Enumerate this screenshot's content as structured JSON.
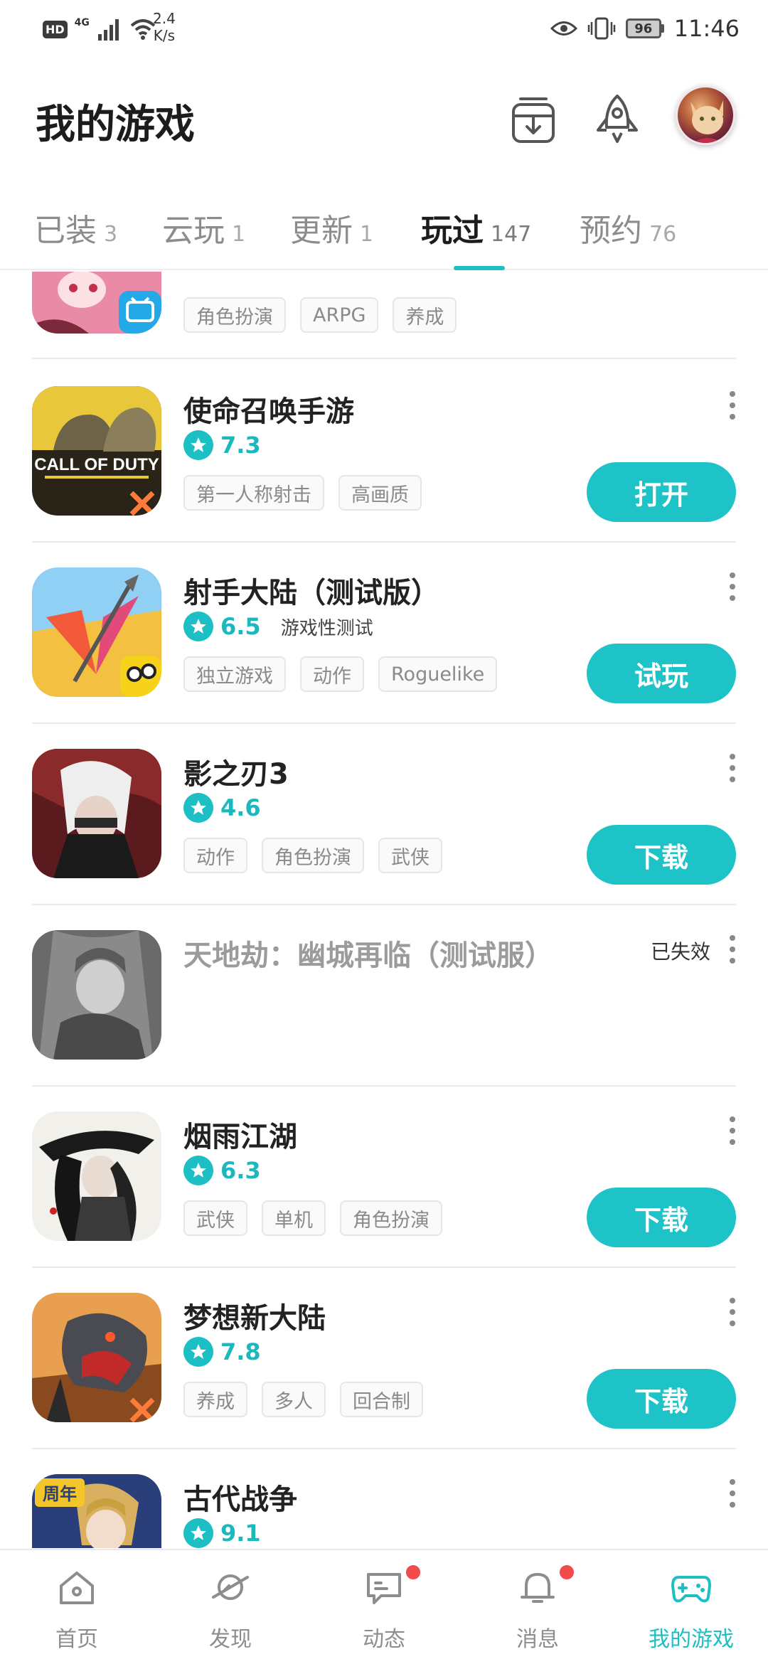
{
  "status_bar": {
    "hd": "HD",
    "network": "4G",
    "speed_value": "2.4",
    "speed_unit": "K/s",
    "battery": "96",
    "time": "11:46"
  },
  "header": {
    "title": "我的游戏",
    "download_icon": "download-tray-icon",
    "rocket_icon": "rocket-icon",
    "avatar": "user-avatar"
  },
  "tabs": [
    {
      "label": "已装",
      "count": "3"
    },
    {
      "label": "云玩",
      "count": "1"
    },
    {
      "label": "更新",
      "count": "1"
    },
    {
      "label": "玩过",
      "count": "147",
      "active": true
    },
    {
      "label": "预约",
      "count": "76"
    }
  ],
  "games": [
    {
      "name": "",
      "tags": [
        "角色扮演",
        "ARPG",
        "养成"
      ]
    },
    {
      "name": "使命召唤手游",
      "rating": "7.3",
      "tags": [
        "第一人称射击",
        "高画质"
      ],
      "action": "打开"
    },
    {
      "name": "射手大陆（测试版）",
      "rating": "6.5",
      "note": "游戏性测试",
      "tags": [
        "独立游戏",
        "动作",
        "Roguelike"
      ],
      "action": "试玩"
    },
    {
      "name": "影之刃3",
      "rating": "4.6",
      "tags": [
        "动作",
        "角色扮演",
        "武侠"
      ],
      "action": "下载"
    },
    {
      "name": "天地劫：幽城再临（测试服）",
      "status": "已失效"
    },
    {
      "name": "烟雨江湖",
      "rating": "6.3",
      "tags": [
        "武侠",
        "单机",
        "角色扮演"
      ],
      "action": "下载"
    },
    {
      "name": "梦想新大陆",
      "rating": "7.8",
      "tags": [
        "养成",
        "多人",
        "回合制"
      ],
      "action": "下载"
    },
    {
      "name": "古代战争",
      "rating": "9.1"
    }
  ],
  "icon_badges": {
    "call_of_duty": "CALL OF DUTY",
    "anniversary": "周年"
  },
  "bottom_nav": [
    {
      "label": "首页",
      "icon": "home-icon"
    },
    {
      "label": "发现",
      "icon": "planet-icon"
    },
    {
      "label": "动态",
      "icon": "chat-icon",
      "badge": true
    },
    {
      "label": "消息",
      "icon": "bell-icon",
      "badge": true
    },
    {
      "label": "我的游戏",
      "icon": "gamepad-icon",
      "active": true
    }
  ],
  "colors": {
    "accent": "#1ec3c8",
    "badge": "#f24b4b"
  }
}
